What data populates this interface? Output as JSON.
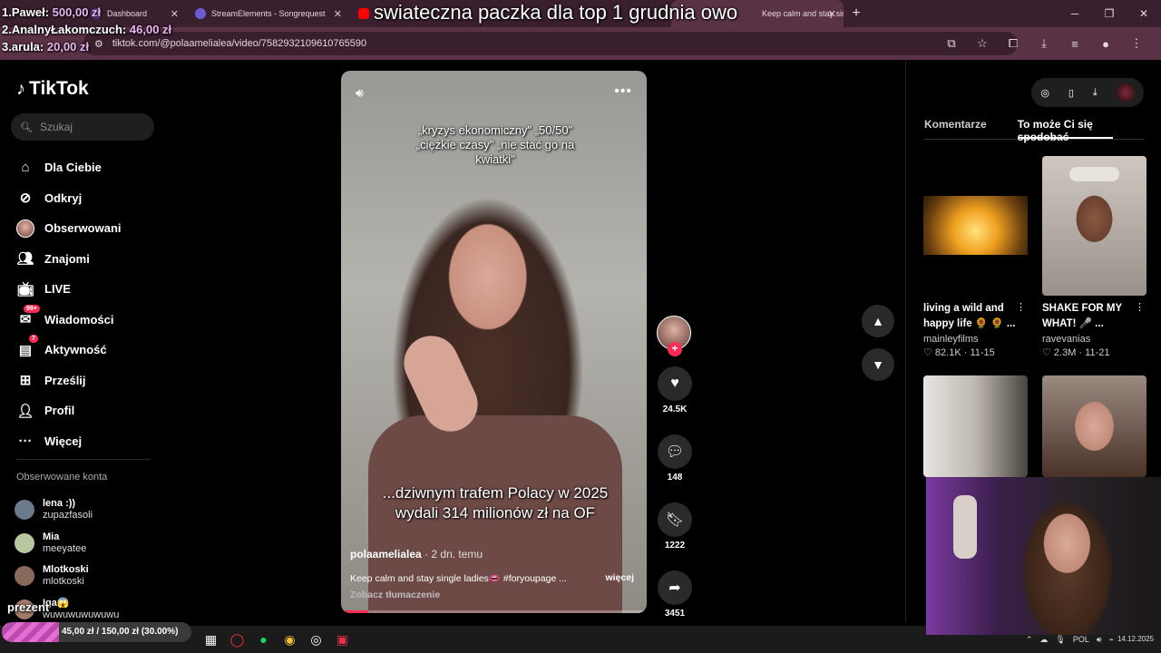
{
  "browser": {
    "tabs": [
      {
        "label": "Dashboard",
        "favicon_color": "#6b3fa0"
      },
      {
        "label": "StreamElements - Songrequest",
        "favicon_color": "#6b5bd6"
      },
      {
        "label": "",
        "favicon_color": "#ff0000"
      },
      {
        "label": "",
        "favicon_color": "#ff0000"
      },
      {
        "label": "Keep calm and stay single ladi",
        "favicon_color": "#111111"
      }
    ],
    "url": "tiktok.com/@polaamelialea/video/7582932109610765590"
  },
  "overlay": {
    "title": "swiateczna paczka dla top 1 grudnia owo",
    "leaderboard": [
      {
        "rank": "1.",
        "name": "Paweł:",
        "amount": "500,00 zł"
      },
      {
        "rank": "2.",
        "name": "AnalnyŁakomczuch:",
        "amount": "46,00 zł"
      },
      {
        "rank": "3.",
        "name": "arula:",
        "amount": "20,00 zł"
      }
    ],
    "prezent_label": "prezent",
    "goal_text": "45,00 zł / 150,00 zł (30.00%)",
    "goal_fraction": 0.3
  },
  "tiktok": {
    "logo": "TikTok",
    "search_placeholder": "Szukaj",
    "nav": [
      {
        "label": "Dla Ciebie",
        "icon": "home-icon"
      },
      {
        "label": "Odkryj",
        "icon": "compass-icon"
      },
      {
        "label": "Obserwowani",
        "icon": "avatar"
      },
      {
        "label": "Znajomi",
        "icon": "friends-icon"
      },
      {
        "label": "LIVE",
        "icon": "live-icon"
      },
      {
        "label": "Wiadomości",
        "icon": "messages-icon",
        "badge": "99+"
      },
      {
        "label": "Aktywność",
        "icon": "activity-icon",
        "badge": "7"
      },
      {
        "label": "Prześlij",
        "icon": "upload-icon"
      },
      {
        "label": "Profil",
        "icon": "profile-icon"
      },
      {
        "label": "Więcej",
        "icon": "more-icon"
      }
    ],
    "following_title": "Obserwowane konta",
    "following": [
      {
        "name": "lena :))",
        "handle": "zupazfasoli",
        "color": "#6a7a8a"
      },
      {
        "name": "Mia",
        "handle": "meeyatee",
        "color": "#b9c7a0"
      },
      {
        "name": "Mlotkoski",
        "handle": "mlotkoski",
        "color": "#8a6a5a"
      },
      {
        "name": "Iga😱",
        "handle": "wuwuwuwuwuwu",
        "color": "#a07a6a"
      }
    ],
    "video": {
      "top_text": "„kryzys ekonomiczny\" „50/50\" „ciężkie czasy\" „nie stać go na kwiatki\"",
      "bottom_text": "...dziwnym trafem Polacy w 2025 wydali 314 milionów zł na OF",
      "author": "polaamelialea",
      "time": " · 2 dn. temu",
      "caption": "Keep calm and stay single ladies👄 #foryoupage ...",
      "more": "więcej",
      "translate": "Zobacz tłumaczenie",
      "progress": 0.09
    },
    "actions": {
      "likes": "24.5K",
      "comments": "148",
      "saves": "1222",
      "shares": "3451"
    },
    "right": {
      "tabs": [
        "Komentarze",
        "To może Ci się spodobać"
      ],
      "cards": [
        {
          "title": "living a wild and happy life 🌻 🌻 ...",
          "author": "mainleyfilms",
          "stats": "♡ 82.1K · 11-15"
        },
        {
          "title": "SHAKE FOR MY WHAT! 🎤 ...",
          "author": "ravevanias",
          "stats": "♡ 2.3M · 11-21"
        }
      ]
    }
  },
  "taskbar": {
    "lang": "POL",
    "date": "14.12.2025"
  }
}
